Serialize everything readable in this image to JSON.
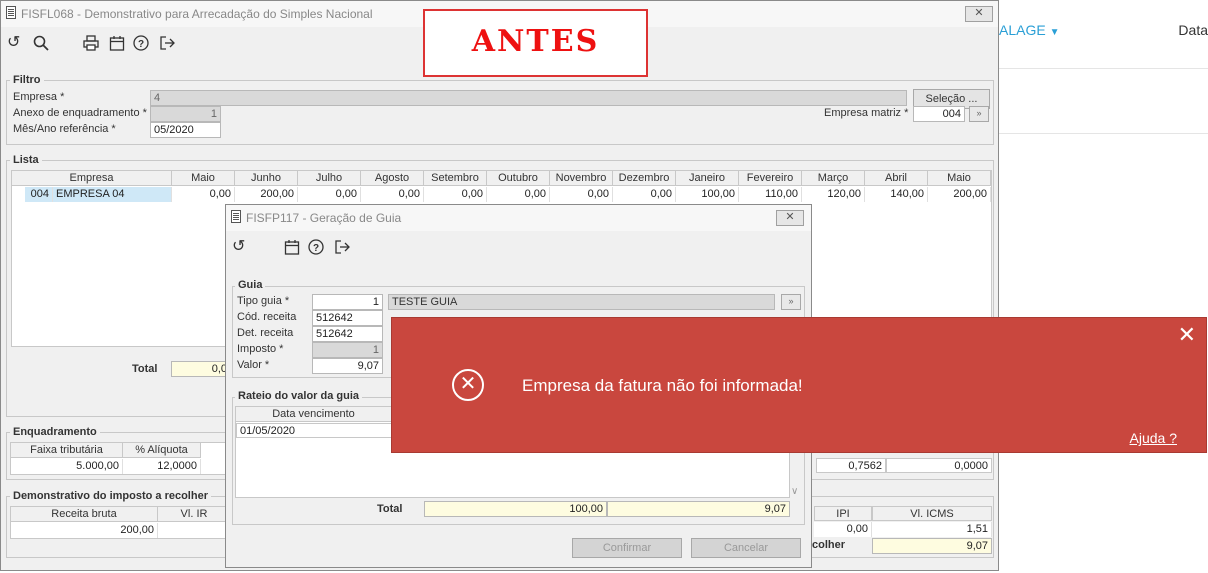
{
  "background_app": {
    "menu_label": "ALAGE",
    "data_label": "Data"
  },
  "annotation": "ANTES",
  "main_window": {
    "title": "FISFL068 - Demonstrativo para Arrecadação do Simples Nacional",
    "close_icon": "close-icon",
    "toolbar": [
      "undo-icon",
      "search-icon",
      "print-icon",
      "calendar-icon",
      "help-icon",
      "exit-icon"
    ],
    "filtro": {
      "title": "Filtro",
      "empresa_label": "Empresa *",
      "empresa_value": "4",
      "selecao_button": "Seleção ...",
      "anexo_label": "Anexo de enquadramento *",
      "anexo_value": "1",
      "empresa_matriz_label": "Empresa matriz *",
      "empresa_matriz_value": "004",
      "mes_label": "Mês/Ano referência *",
      "mes_value": "05/2020"
    },
    "lista": {
      "title": "Lista",
      "columns": [
        "Empresa",
        "Maio",
        "Junho",
        "Julho",
        "Agosto",
        "Setembro",
        "Outubro",
        "Novembro",
        "Dezembro",
        "Janeiro",
        "Fevereiro",
        "Março",
        "Abril",
        "Maio"
      ],
      "row": {
        "code": "004",
        "name": "EMPRESA 04",
        "values": [
          "0,00",
          "200,00",
          "0,00",
          "0,00",
          "0,00",
          "0,00",
          "0,00",
          "0,00",
          "100,00",
          "110,00",
          "120,00",
          "140,00",
          "200,00"
        ]
      },
      "total_label": "Total",
      "total_value": "0,0"
    },
    "enquadramento": {
      "title": "Enquadramento",
      "col_faixa": "Faixa tributária",
      "col_aliquota": "% Alíquota",
      "faixa_value": "5.000,00",
      "aliquota_value": "12,0000",
      "right_val1": "0,7562",
      "right_val2": "0,0000"
    },
    "demonstrativo": {
      "title": "Demonstrativo do imposto a recolher",
      "col_receita": "Receita bruta",
      "col_vlir": "Vl. IR",
      "receita_value": "200,00",
      "col_ipi": "IPI",
      "col_icms": "Vl. ICMS",
      "ipi_value": "0,00",
      "icms_value": "1,51",
      "recolher_label": "colher",
      "recolher_value": "9,07"
    }
  },
  "dialog": {
    "title": "FISFP117 - Geração de Guia",
    "toolbar": [
      "undo-icon",
      "calendar-icon",
      "help-icon",
      "exit-icon"
    ],
    "guia": {
      "title": "Guia",
      "tipo_label": "Tipo guia *",
      "tipo_value": "1",
      "tipo_desc": "TESTE GUIA",
      "cod_label": "Cód. receita",
      "cod_value": "512642",
      "det_label": "Det. receita",
      "det_value": "512642",
      "imposto_label": "Imposto *",
      "imposto_value": "1",
      "valor_label": "Valor *",
      "valor_value": "9,07"
    },
    "rateio": {
      "title": "Rateio do valor da guia",
      "col_data": "Data vencimento",
      "row_date": "01/05/2020",
      "total_label": "Total",
      "total_pct": "100,00",
      "total_val": "9,07"
    },
    "confirmar": "Confirmar",
    "cancelar": "Cancelar"
  },
  "error_toast": {
    "message": "Empresa da fatura não foi informada!",
    "help": "Ajuda ?",
    "color": "#c9473e"
  }
}
